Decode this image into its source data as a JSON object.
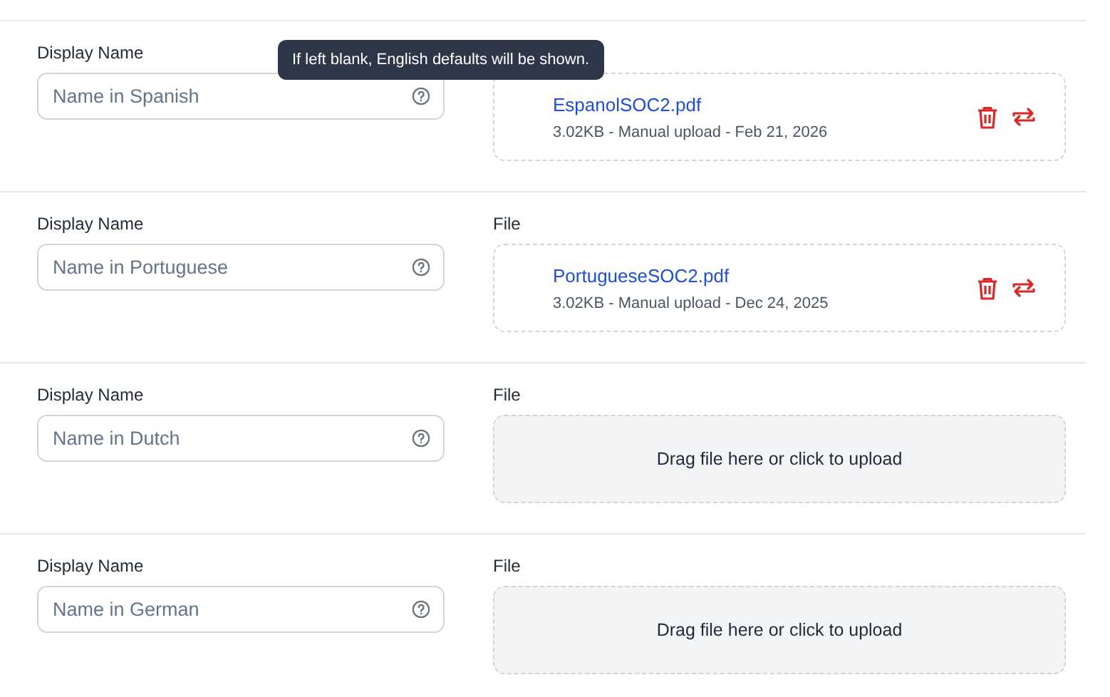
{
  "tooltip": "If left blank, English defaults will be shown.",
  "rows": [
    {
      "name_label": "Display Name",
      "placeholder": "Name in Spanish",
      "file": {
        "kind": "uploaded",
        "name": "EspanolSOC2.pdf",
        "meta": "3.02KB - Manual upload - Feb 21, 2026"
      }
    },
    {
      "name_label": "Display Name",
      "placeholder": "Name in Portuguese",
      "file_label": "File",
      "file": {
        "kind": "uploaded",
        "name": "PortugueseSOC2.pdf",
        "meta": "3.02KB - Manual upload - Dec 24, 2025"
      }
    },
    {
      "name_label": "Display Name",
      "placeholder": "Name in Dutch",
      "file_label": "File",
      "file": {
        "kind": "empty",
        "prompt": "Drag file here or click to upload"
      }
    },
    {
      "name_label": "Display Name",
      "placeholder": "Name in German",
      "file_label": "File",
      "file": {
        "kind": "empty",
        "prompt": "Drag file here or click to upload"
      }
    }
  ]
}
